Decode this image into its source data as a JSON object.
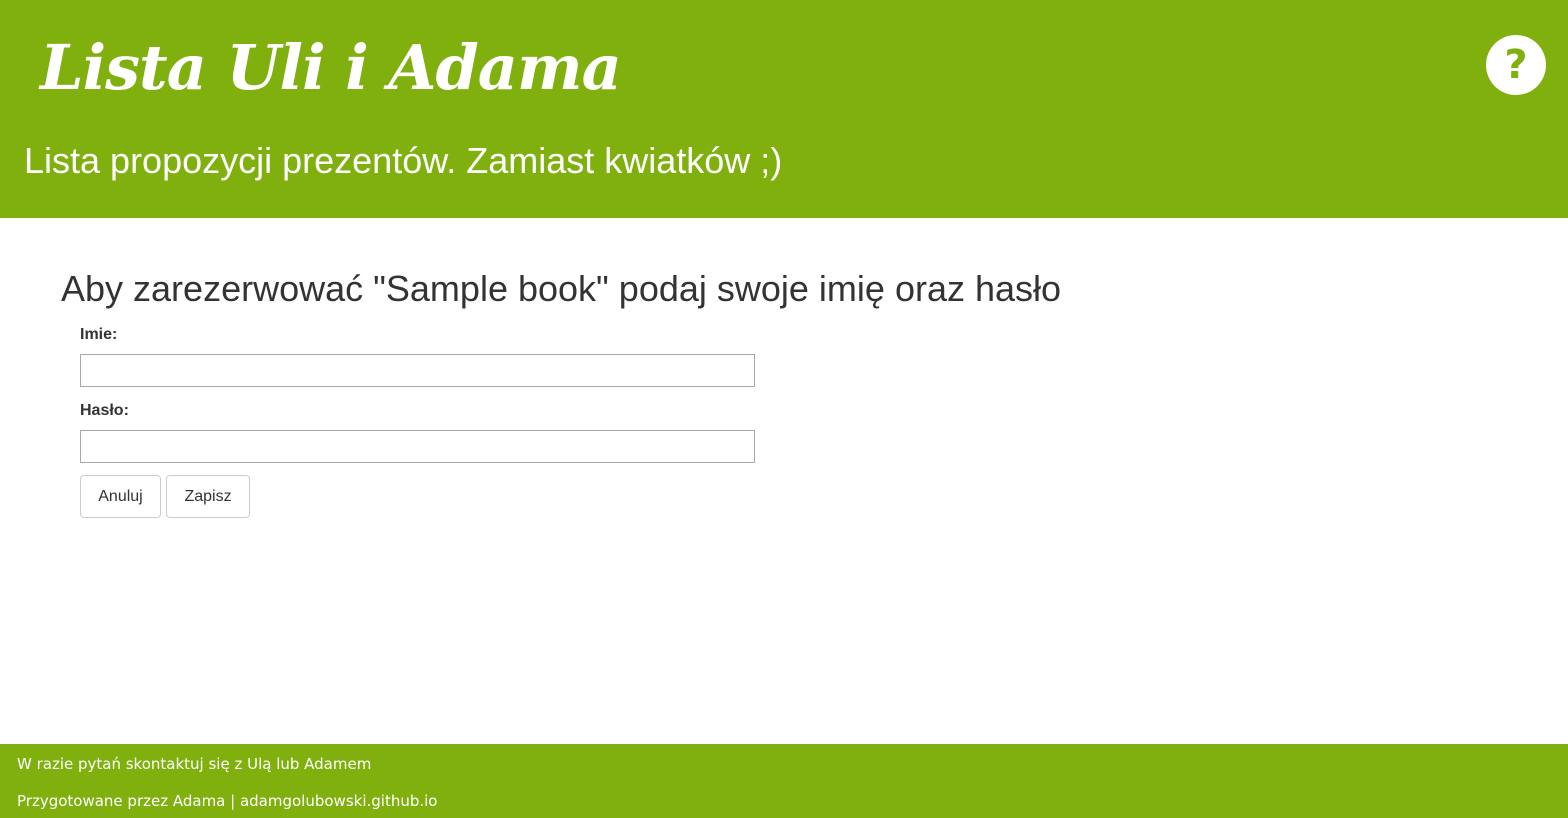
{
  "header": {
    "logo": "Lista Uli i Adama",
    "subtitle": "Lista propozycji prezentów. Zamiast kwiatków ;)",
    "help_icon": "question-mark-icon",
    "help_symbol": "?"
  },
  "main": {
    "heading": "Aby zarezerwować \"Sample book\" podaj swoje imię oraz hasło",
    "form": {
      "name_label": "Imie:",
      "name_value": "",
      "password_label": "Hasło:",
      "password_value": "",
      "cancel_label": "Anuluj",
      "save_label": "Zapisz"
    }
  },
  "footer": {
    "contact_text": "W razie pytań skontaktuj się z Ulą lub Adamem",
    "prepared_by": "Przygotowane przez Adama",
    "separator": " | ",
    "link_text": "adamgolubowski.github.io"
  },
  "colors": {
    "brand_green": "#80b00e",
    "text": "#333333",
    "white": "#ffffff"
  }
}
